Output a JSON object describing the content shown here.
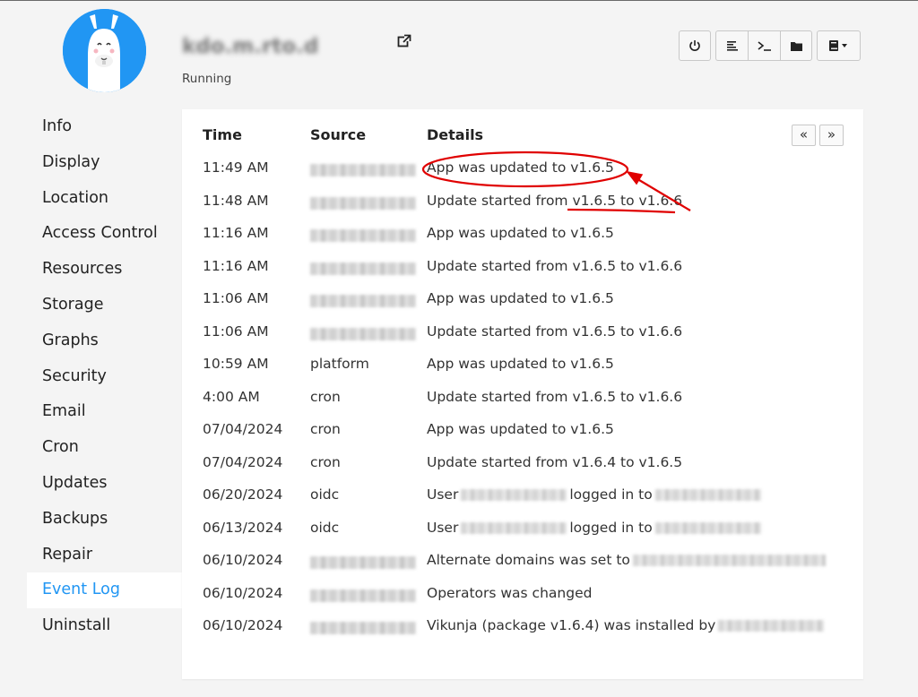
{
  "app": {
    "title": "kdo.m.rto.d",
    "status": "Running"
  },
  "icons": {
    "external_link": "external-link-icon",
    "power": "power-icon",
    "logs": "logs-icon",
    "terminal": "terminal-icon",
    "folder": "folder-icon",
    "book_menu": "book-dropdown-icon",
    "first_page": "double-chevron-left-icon",
    "next_page": "double-chevron-right-icon"
  },
  "colors": {
    "accent": "#2196f3",
    "annotation": "#e00000"
  },
  "sidebar": {
    "items": [
      {
        "label": "Info"
      },
      {
        "label": "Display"
      },
      {
        "label": "Location"
      },
      {
        "label": "Access Control"
      },
      {
        "label": "Resources"
      },
      {
        "label": "Storage"
      },
      {
        "label": "Graphs"
      },
      {
        "label": "Security"
      },
      {
        "label": "Email"
      },
      {
        "label": "Cron"
      },
      {
        "label": "Updates"
      },
      {
        "label": "Backups"
      },
      {
        "label": "Repair"
      },
      {
        "label": "Event Log",
        "active": true
      },
      {
        "label": "Uninstall"
      }
    ]
  },
  "table": {
    "headers": {
      "time": "Time",
      "source": "Source",
      "details": "Details"
    },
    "pager": {
      "first": "«",
      "next": "»"
    },
    "rows": [
      {
        "time": "11:49 AM",
        "source": "",
        "details": "App was updated to v1.6.5"
      },
      {
        "time": "11:48 AM",
        "source": "",
        "details": "Update started from v1.6.5 to v1.6.6"
      },
      {
        "time": "11:16 AM",
        "source": "",
        "details": "App was updated to v1.6.5"
      },
      {
        "time": "11:16 AM",
        "source": "",
        "details": "Update started from v1.6.5 to v1.6.6"
      },
      {
        "time": "11:06 AM",
        "source": "",
        "details": "App was updated to v1.6.5"
      },
      {
        "time": "11:06 AM",
        "source": "",
        "details": "Update started from v1.6.5 to v1.6.6"
      },
      {
        "time": "10:59 AM",
        "source": "platform",
        "details": "App was updated to v1.6.5"
      },
      {
        "time": "4:00 AM",
        "source": "cron",
        "details": "Update started from v1.6.5 to v1.6.6"
      },
      {
        "time": "07/04/2024",
        "source": "cron",
        "details": "App was updated to v1.6.5"
      },
      {
        "time": "07/04/2024",
        "source": "cron",
        "details": "Update started from v1.6.4 to v1.6.5"
      },
      {
        "time": "06/20/2024",
        "source": "oidc",
        "details_parts": [
          "User",
          "logged in to"
        ]
      },
      {
        "time": "06/13/2024",
        "source": "oidc",
        "details_parts": [
          "User",
          "logged in to"
        ]
      },
      {
        "time": "06/10/2024",
        "source": "",
        "details_parts": [
          "Alternate domains was set to"
        ]
      },
      {
        "time": "06/10/2024",
        "source": "",
        "details": "Operators was changed"
      },
      {
        "time": "06/10/2024",
        "source": "",
        "details_parts": [
          "Vikunja (package v1.6.4) was installed by"
        ]
      }
    ]
  }
}
